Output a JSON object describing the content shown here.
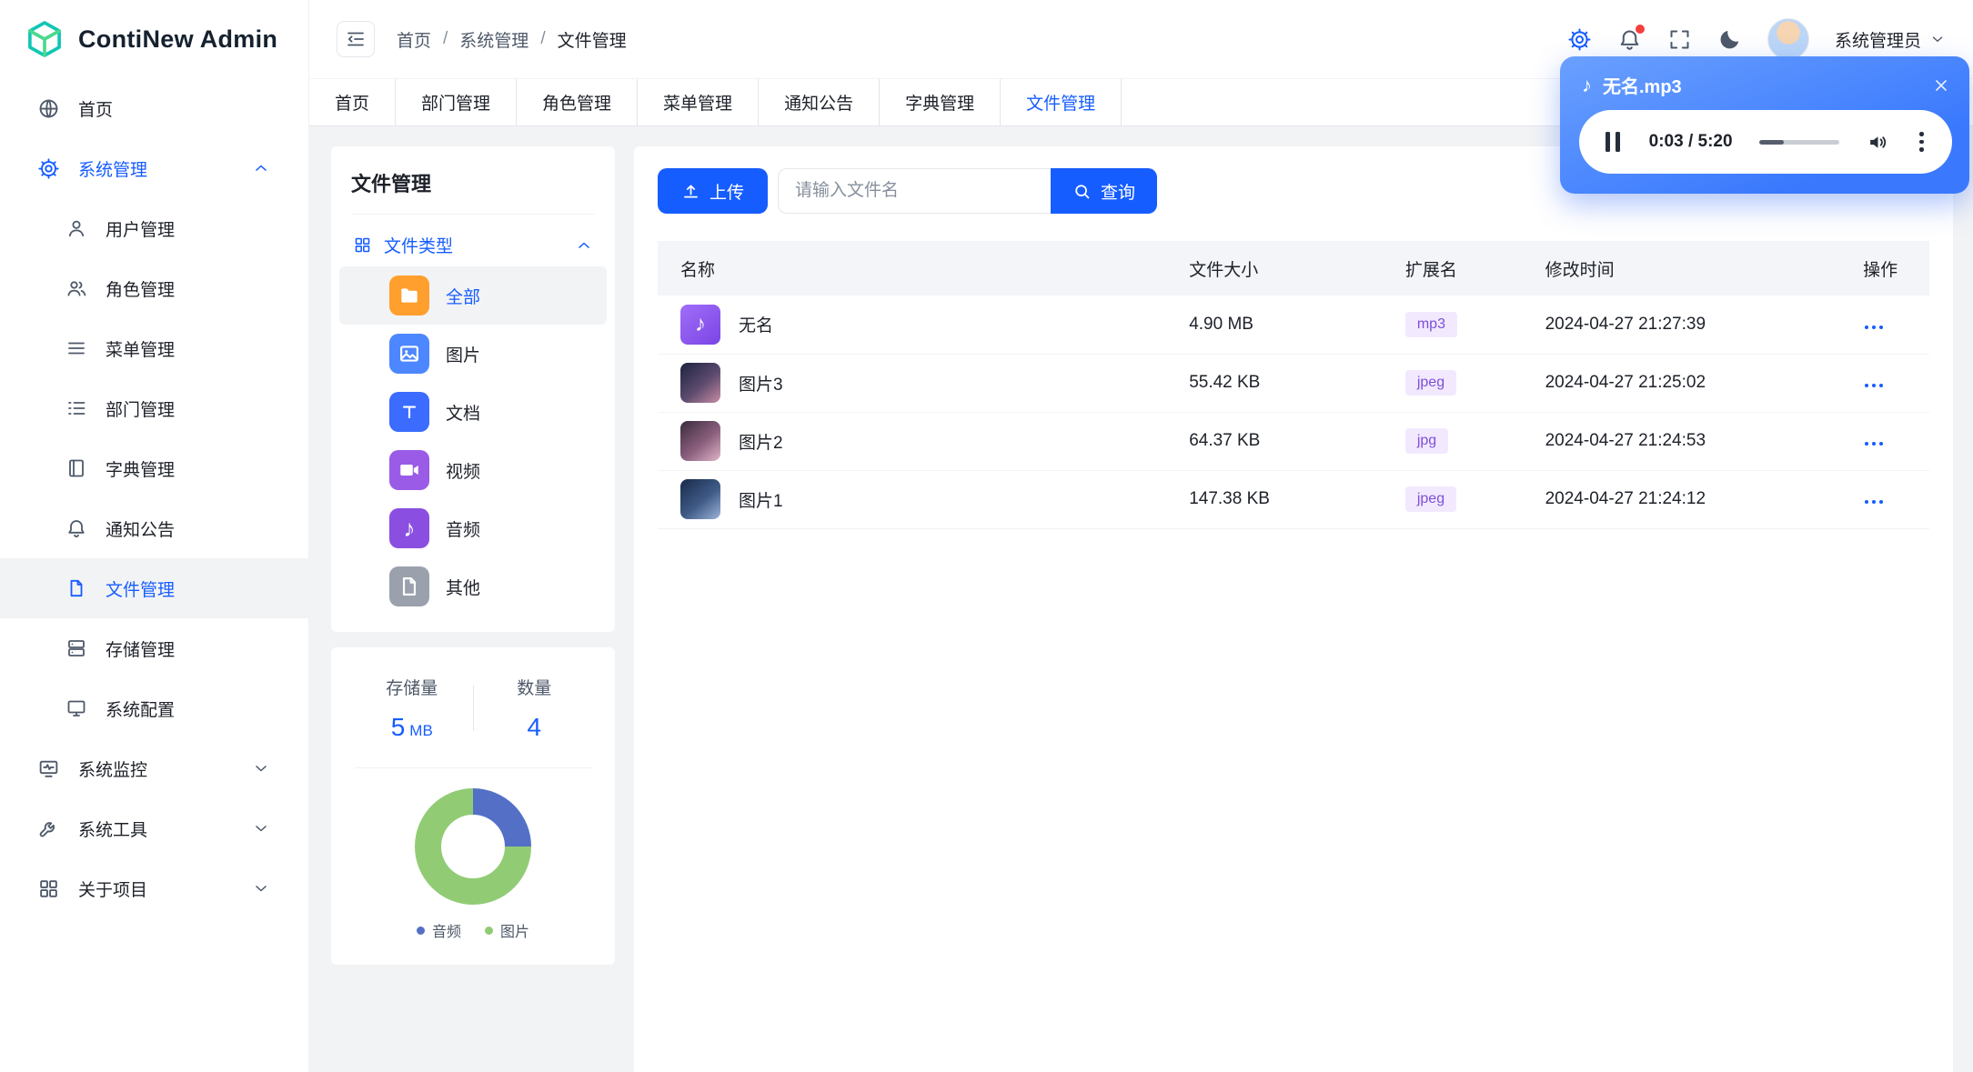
{
  "app": {
    "name": "ContiNew Admin"
  },
  "colors": {
    "primary": "#165dff",
    "sidebar_active_bg": "#f2f3f5",
    "badge_bg": "#f2e9ff",
    "badge_text": "#7e4fd8",
    "notification_dot": "#f53f3f"
  },
  "header": {
    "breadcrumbs": [
      "首页",
      "系统管理",
      "文件管理"
    ],
    "breadcrumb_separator": "/",
    "username": "系统管理员"
  },
  "tabs": [
    "首页",
    "部门管理",
    "角色管理",
    "菜单管理",
    "通知公告",
    "字典管理",
    "文件管理"
  ],
  "active_tab": "文件管理",
  "sidebar": {
    "home_label": "首页",
    "system": {
      "label": "系统管理",
      "children": [
        "用户管理",
        "角色管理",
        "菜单管理",
        "部门管理",
        "字典管理",
        "通知公告",
        "文件管理",
        "存储管理",
        "系统配置"
      ],
      "active_child": "文件管理"
    },
    "groups": [
      "系统监控",
      "系统工具",
      "关于项目"
    ]
  },
  "file_panel": {
    "title": "文件管理",
    "group_label": "文件类型",
    "active_type": "全部",
    "types": [
      {
        "label": "全部",
        "icon": "folder-icon",
        "color": "#ff9f2e"
      },
      {
        "label": "图片",
        "icon": "image-icon",
        "color": "#4c87ff"
      },
      {
        "label": "文档",
        "icon": "text-doc-icon",
        "color": "#3b6cff"
      },
      {
        "label": "视频",
        "icon": "video-icon",
        "color": "#9a5ce6"
      },
      {
        "label": "音频",
        "icon": "music-icon",
        "color": "#8a4fe0"
      },
      {
        "label": "其他",
        "icon": "file-icon",
        "color": "#9aa1ad"
      }
    ],
    "stats": {
      "storage_label": "存储量",
      "storage_value": "5",
      "storage_unit": "MB",
      "count_label": "数量",
      "count_value": "4"
    }
  },
  "chart_data": {
    "type": "pie",
    "donut": true,
    "categories": [
      "音频",
      "图片"
    ],
    "values": [
      1,
      3
    ],
    "colors": [
      "#5470c6",
      "#91cc75"
    ],
    "legend_position": "bottom"
  },
  "toolbar": {
    "upload_label": "上传",
    "search_placeholder": "请输入文件名",
    "query_label": "查询"
  },
  "table": {
    "columns": [
      "名称",
      "文件大小",
      "扩展名",
      "修改时间",
      "操作"
    ],
    "rows": [
      {
        "name": "无名",
        "size": "4.90 MB",
        "ext": "mp3",
        "time": "2024-04-27 21:27:39",
        "icon": "music-file-icon"
      },
      {
        "name": "图片3",
        "size": "55.42 KB",
        "ext": "jpeg",
        "time": "2024-04-27 21:25:02",
        "icon": "image-thumbnail"
      },
      {
        "name": "图片2",
        "size": "64.37 KB",
        "ext": "jpg",
        "time": "2024-04-27 21:24:53",
        "icon": "image-thumbnail"
      },
      {
        "name": "图片1",
        "size": "147.38 KB",
        "ext": "jpeg",
        "time": "2024-04-27 21:24:12",
        "icon": "image-thumbnail"
      }
    ]
  },
  "player": {
    "title": "无名.mp3",
    "time_display": "0:03 / 5:20",
    "progress_pct": 30
  }
}
